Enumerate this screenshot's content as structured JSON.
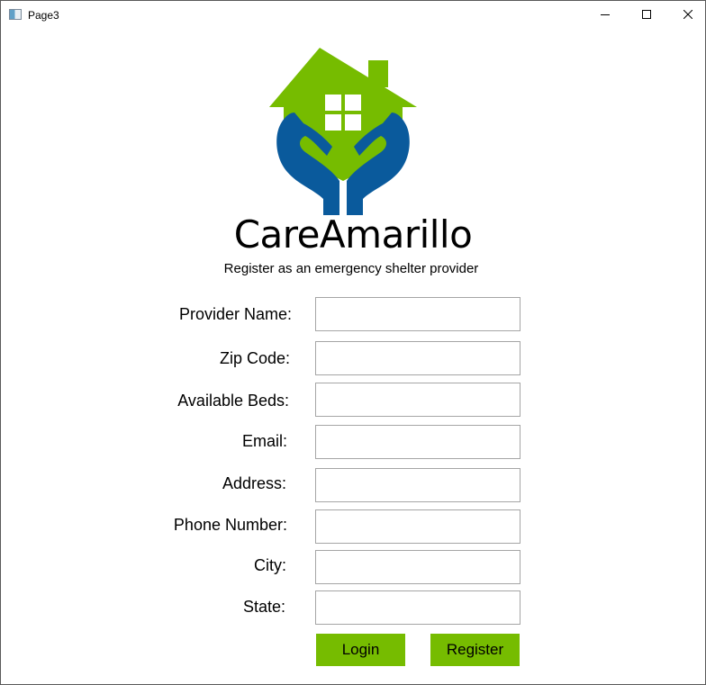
{
  "window": {
    "title": "Page3",
    "icon": "app-window-icon",
    "controls": [
      "minimize-icon",
      "maximize-icon",
      "close-icon"
    ]
  },
  "brand": {
    "logo_icon": "house-in-hands-logo",
    "name": "CareAmarillo",
    "subtitle": "Register as an emergency shelter provider",
    "colors": {
      "green": "#76bc00",
      "blue": "#0a5a9c"
    }
  },
  "form": {
    "fields": [
      {
        "label": "Provider Name:",
        "value": ""
      },
      {
        "label": "Zip Code:",
        "value": ""
      },
      {
        "label": "Available Beds:",
        "value": ""
      },
      {
        "label": "Email:",
        "value": ""
      },
      {
        "label": "Address:",
        "value": ""
      },
      {
        "label": "Phone Number:",
        "value": ""
      },
      {
        "label": "City:",
        "value": ""
      },
      {
        "label": "State:",
        "value": ""
      }
    ],
    "buttons": {
      "login": "Login",
      "register": "Register"
    }
  }
}
